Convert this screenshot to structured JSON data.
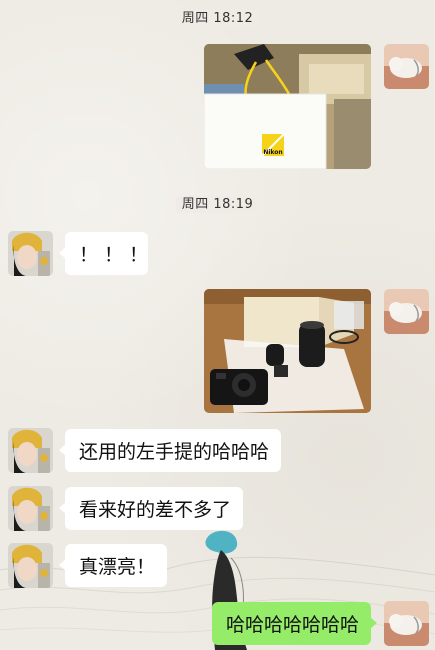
{
  "chat": {
    "timestamps": [
      "周四 18:12",
      "周四 18:19"
    ],
    "messages": [
      {
        "from": "me",
        "kind": "image",
        "subject": "Nikon shopping bag"
      },
      {
        "from": "friend",
        "kind": "text",
        "text": "！！！"
      },
      {
        "from": "me",
        "kind": "image",
        "subject": "Nikon camera kit with lenses on table"
      },
      {
        "from": "friend",
        "kind": "text",
        "text": "还用的左手提的哈哈哈"
      },
      {
        "from": "friend",
        "kind": "text",
        "text": "看来好的差不多了"
      },
      {
        "from": "friend",
        "kind": "text",
        "text": "真漂亮！"
      },
      {
        "from": "me",
        "kind": "text",
        "text": "哈哈哈哈哈哈哈"
      }
    ],
    "bag_brand": "Nikon"
  },
  "colors": {
    "background": "#eeebe4",
    "incoming_bubble": "#ffffff",
    "outgoing_bubble": "#95ec69",
    "nikon_yellow": "#f6d31a"
  }
}
